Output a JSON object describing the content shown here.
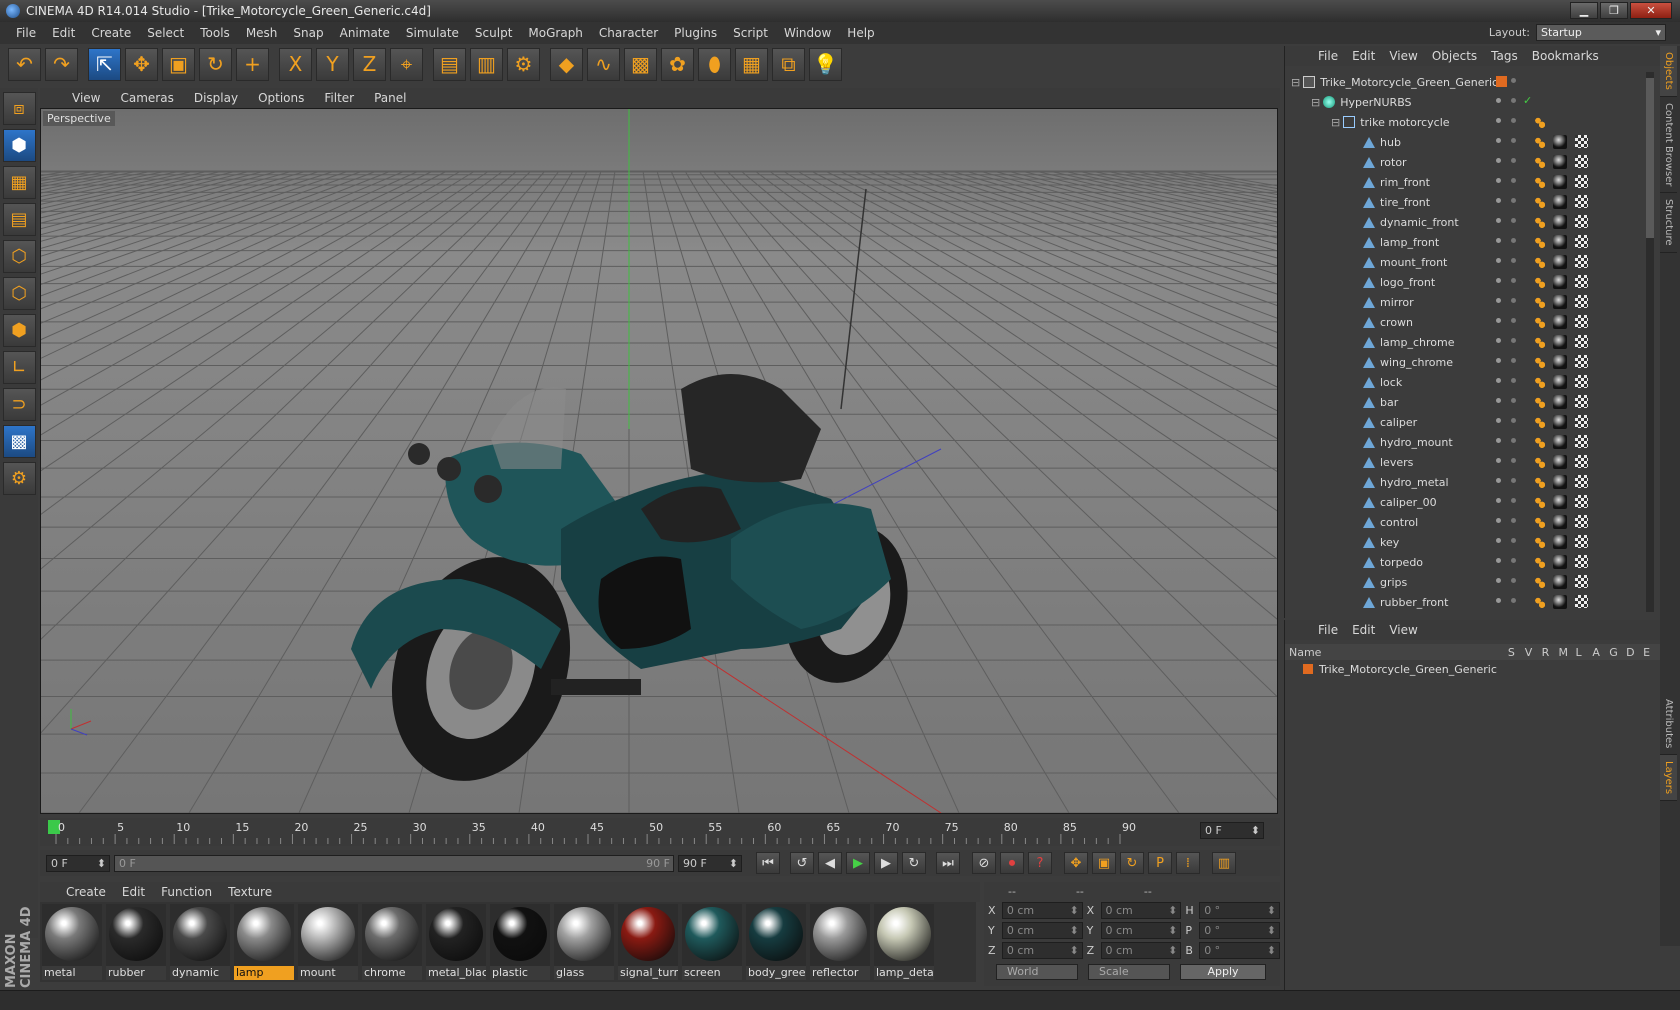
{
  "window": {
    "title": "CINEMA 4D R14.014 Studio - [Trike_Motorcycle_Green_Generic.c4d]"
  },
  "menu": [
    "File",
    "Edit",
    "Create",
    "Select",
    "Tools",
    "Mesh",
    "Snap",
    "Animate",
    "Simulate",
    "Sculpt",
    "MoGraph",
    "Character",
    "Plugins",
    "Script",
    "Window",
    "Help"
  ],
  "layout": {
    "label": "Layout:",
    "value": "Startup"
  },
  "toolbar_icons": [
    "undo-icon",
    "redo-icon",
    "live-selection-icon",
    "move-icon",
    "scale-icon",
    "rotate-icon",
    "add-icon",
    "x-axis-icon",
    "y-axis-icon",
    "z-axis-icon",
    "coordinate-system-icon",
    "render-view-icon",
    "render-picture-viewer-icon",
    "render-settings-icon",
    "cube-icon",
    "spline-icon",
    "nurbs-icon",
    "array-icon",
    "deformer-icon",
    "floor-icon",
    "camera-icon",
    "light-icon"
  ],
  "toolbar_glyphs": [
    "↶",
    "↷",
    "⇱",
    "✥",
    "▣",
    "↻",
    "+",
    "X",
    "Y",
    "Z",
    "⌖",
    "▤",
    "▥",
    "⚙",
    "◆",
    "∿",
    "▩",
    "✿",
    "⬮",
    "▦",
    "⧉",
    "💡"
  ],
  "left_tools": [
    {
      "icon": "make-editable-icon",
      "glyph": "⧈"
    },
    {
      "icon": "model-mode-icon",
      "glyph": "⬢",
      "active": true
    },
    {
      "icon": "texture-mode-icon",
      "glyph": "▦"
    },
    {
      "icon": "workplane-icon",
      "glyph": "▤"
    },
    {
      "icon": "points-mode-icon",
      "glyph": "⬡"
    },
    {
      "icon": "edges-mode-icon",
      "glyph": "⬡"
    },
    {
      "icon": "polygons-mode-icon",
      "glyph": "⬢"
    },
    {
      "icon": "axis-mode-icon",
      "glyph": "∟"
    },
    {
      "icon": "snap-icon",
      "glyph": "⊃"
    },
    {
      "icon": "workplane-lock-icon",
      "glyph": "▩",
      "active": true
    },
    {
      "icon": "grid-snap-icon",
      "glyph": "⚙"
    }
  ],
  "viewport": {
    "menu": [
      "View",
      "Cameras",
      "Display",
      "Options",
      "Filter",
      "Panel"
    ],
    "label": "Perspective"
  },
  "timeline": {
    "ticks": [
      "0",
      "5",
      "10",
      "15",
      "20",
      "25",
      "30",
      "35",
      "40",
      "45",
      "50",
      "55",
      "60",
      "65",
      "70",
      "75",
      "80",
      "85",
      "90"
    ],
    "current": "0 F"
  },
  "transport": {
    "start": "0 F",
    "range_start": "0 F",
    "range_end": "90 F",
    "end": "90 F"
  },
  "material_menu": [
    "Create",
    "Edit",
    "Function",
    "Texture"
  ],
  "materials": [
    {
      "name": "metal",
      "color": "#7a7a7a",
      "selected": false
    },
    {
      "name": "rubber",
      "color": "#2a2a2a",
      "selected": false
    },
    {
      "name": "dynamic",
      "color": "#4a4a4a",
      "selected": false
    },
    {
      "name": "lamp",
      "color": "#8a8a8a",
      "selected": true
    },
    {
      "name": "mount",
      "color": "#b8b8b8",
      "selected": false
    },
    {
      "name": "chrome",
      "color": "#6c6c6c",
      "selected": false
    },
    {
      "name": "metal_black",
      "color": "#222222",
      "selected": false
    },
    {
      "name": "plastic",
      "color": "#111111",
      "selected": false
    },
    {
      "name": "glass",
      "color": "#a0a0a0",
      "selected": false
    },
    {
      "name": "signal_turn",
      "color": "#8a1a12",
      "selected": false
    },
    {
      "name": "screen",
      "color": "#1f5a5c",
      "selected": false
    },
    {
      "name": "body_green",
      "color": "#163c40",
      "selected": false
    },
    {
      "name": "reflector",
      "color": "#9a9a9a",
      "selected": false
    },
    {
      "name": "lamp_detail",
      "color": "#c6c8b4",
      "selected": false
    }
  ],
  "coords": {
    "headers": [
      "--",
      "--",
      "--"
    ],
    "rows": [
      {
        "a": "X",
        "av": "0 cm",
        "b": "X",
        "bv": "0 cm",
        "c": "H",
        "cv": "0 °"
      },
      {
        "a": "Y",
        "av": "0 cm",
        "b": "Y",
        "bv": "0 cm",
        "c": "P",
        "cv": "0 °"
      },
      {
        "a": "Z",
        "av": "0 cm",
        "b": "Z",
        "bv": "0 cm",
        "c": "B",
        "cv": "0 °"
      }
    ],
    "mode": "World",
    "scale": "Scale",
    "apply": "Apply"
  },
  "objects_menu": [
    "File",
    "Edit",
    "View",
    "Objects",
    "Tags",
    "Bookmarks"
  ],
  "objects": [
    {
      "name": "Trike_Motorcycle_Green_Generic",
      "level": 0,
      "icon": "root"
    },
    {
      "name": "HyperNURBS",
      "level": 1,
      "icon": "nurbs"
    },
    {
      "name": "trike motorcycle",
      "level": 2,
      "icon": "null"
    },
    {
      "name": "hub",
      "level": 3,
      "icon": "tri"
    },
    {
      "name": "rotor",
      "level": 3,
      "icon": "tri"
    },
    {
      "name": "rim_front",
      "level": 3,
      "icon": "tri"
    },
    {
      "name": "tire_front",
      "level": 3,
      "icon": "tri"
    },
    {
      "name": "dynamic_front",
      "level": 3,
      "icon": "tri"
    },
    {
      "name": "lamp_front",
      "level": 3,
      "icon": "tri"
    },
    {
      "name": "mount_front",
      "level": 3,
      "icon": "tri"
    },
    {
      "name": "logo_front",
      "level": 3,
      "icon": "tri"
    },
    {
      "name": "mirror",
      "level": 3,
      "icon": "tri"
    },
    {
      "name": "crown",
      "level": 3,
      "icon": "tri"
    },
    {
      "name": "lamp_chrome",
      "level": 3,
      "icon": "tri"
    },
    {
      "name": "wing_chrome",
      "level": 3,
      "icon": "tri"
    },
    {
      "name": "lock",
      "level": 3,
      "icon": "tri"
    },
    {
      "name": "bar",
      "level": 3,
      "icon": "tri"
    },
    {
      "name": "caliper",
      "level": 3,
      "icon": "tri"
    },
    {
      "name": "hydro_mount",
      "level": 3,
      "icon": "tri"
    },
    {
      "name": "levers",
      "level": 3,
      "icon": "tri"
    },
    {
      "name": "hydro_metal",
      "level": 3,
      "icon": "tri"
    },
    {
      "name": "caliper_00",
      "level": 3,
      "icon": "tri"
    },
    {
      "name": "control",
      "level": 3,
      "icon": "tri"
    },
    {
      "name": "key",
      "level": 3,
      "icon": "tri"
    },
    {
      "name": "torpedo",
      "level": 3,
      "icon": "tri"
    },
    {
      "name": "grips",
      "level": 3,
      "icon": "tri"
    },
    {
      "name": "rubber_front",
      "level": 3,
      "icon": "tri"
    }
  ],
  "layers_menu": [
    "File",
    "Edit",
    "View"
  ],
  "layers_header": {
    "name": "Name",
    "cols": [
      "S",
      "V",
      "R",
      "M",
      "L",
      "A",
      "G",
      "D",
      "E"
    ]
  },
  "layers": [
    {
      "name": "Trike_Motorcycle_Green_Generic",
      "color": "#e06a20"
    }
  ],
  "side_tabs": [
    {
      "label": "Objects",
      "active": true
    },
    {
      "label": "Content Browser",
      "active": false
    },
    {
      "label": "Structure",
      "active": false
    },
    {
      "label": "Attributes",
      "active": false
    },
    {
      "label": "Layers",
      "active": true
    }
  ],
  "brand": {
    "logo": "MAXON CINEMA 4D"
  },
  "colors": {
    "accent": "#f0a020",
    "selection": "#2e75c9",
    "body": "#163c40"
  }
}
